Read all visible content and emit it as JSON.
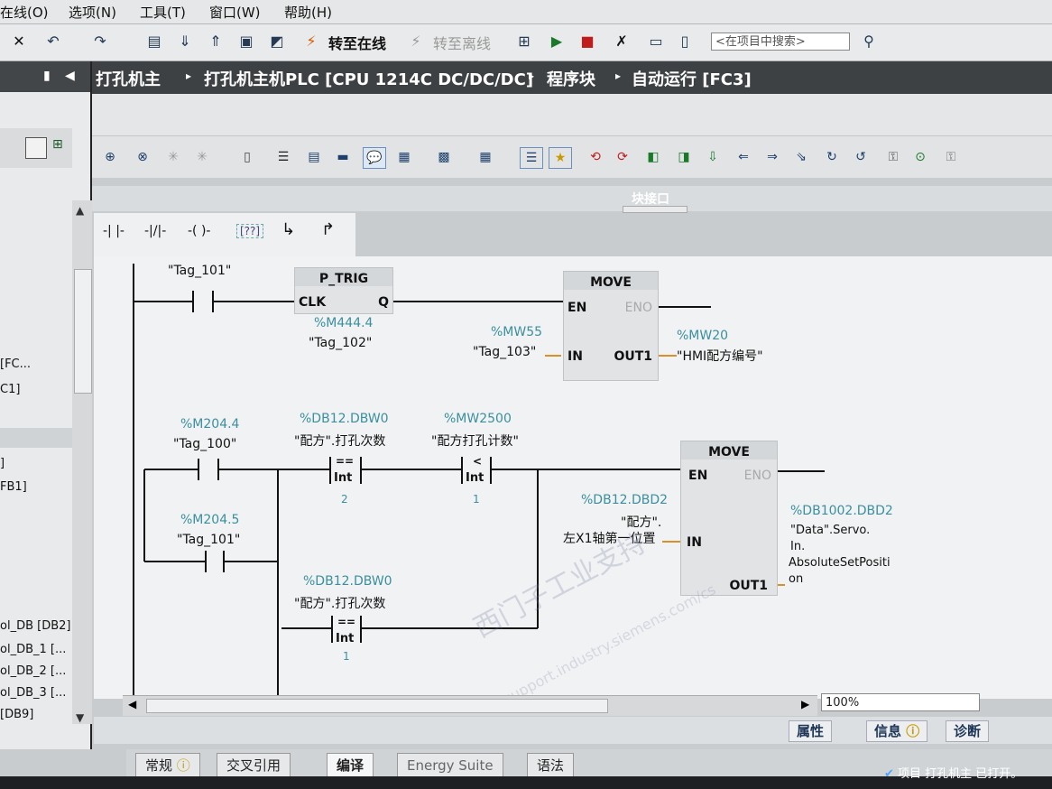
{
  "menu": [
    "在线(O)",
    "选项(N)",
    "工具(T)",
    "窗口(W)",
    "帮助(H)"
  ],
  "toolbar": {
    "go_online": "转至在线",
    "go_offline": "转至离线",
    "search_placeholder": "<在项目中搜索>"
  },
  "breadcrumb": [
    "打孔机主",
    "打孔机主机PLC [CPU 1214C DC/DC/DC]",
    "程序块",
    "自动运行 [FC3]"
  ],
  "block_interface_label": "块接口",
  "left_panel": {
    "items": [
      "[FC...",
      "C1]",
      "]",
      "FB1]",
      "ol_DB [DB2]",
      "ol_DB_1 [...",
      "ol_DB_2 [...",
      "ol_DB_3 [...",
      "[DB9]"
    ]
  },
  "network1": {
    "contact_tag": "\"Tag_101\"",
    "ptrig": {
      "title": "P_TRIG",
      "clk": "CLK",
      "q": "Q",
      "addr": "%M444.4",
      "tag": "\"Tag_102\""
    },
    "move": {
      "title": "MOVE",
      "en": "EN",
      "eno": "ENO",
      "in_addr": "%MW55",
      "in_tag": "\"Tag_103\"",
      "in_pin": "IN",
      "out_pin": "OUT1",
      "out_addr": "%MW20",
      "out_tag": "\"HMI配方编号\""
    }
  },
  "network2": {
    "contact1_addr": "%M204.4",
    "contact1_tag": "\"Tag_100\"",
    "contact2_addr": "%M204.5",
    "contact2_tag": "\"Tag_101\"",
    "cmp1": {
      "addr": "%DB12.DBW0",
      "tag": "\"配方\".打孔次数",
      "op": "==",
      "type": "Int",
      "value": "2"
    },
    "cmp2": {
      "addr": "%MW2500",
      "tag": "\"配方打孔计数\"",
      "op": "<",
      "type": "Int",
      "value": "1"
    },
    "cmp3": {
      "addr": "%DB12.DBW0",
      "tag": "\"配方\".打孔次数",
      "op": "==",
      "type": "Int",
      "value": "1"
    },
    "move": {
      "title": "MOVE",
      "en": "EN",
      "eno": "ENO",
      "in_addr": "%DB12.DBD2",
      "in_tag1": "\"配方\".",
      "in_tag2": "左X1轴第一位置",
      "in_pin": "IN",
      "out_pin": "OUT1",
      "out_addr": "%DB1002.DBD2",
      "out_tag1": "\"Data\".Servo.",
      "out_tag2": "In.",
      "out_tag3": "AbsoluteSetPositi",
      "out_tag4": "on"
    }
  },
  "watermark": {
    "line1": "西门子工业支持",
    "line2": "support.industry.siemens.com/cs"
  },
  "zoom": "100%",
  "properties_tabs": [
    "属性",
    "信息",
    "诊断"
  ],
  "bottom_tabs": [
    "常规",
    "交叉引用",
    "编译",
    "Energy Suite",
    "语法"
  ],
  "status": "项目 打孔机主 已打开。",
  "lad_tools": [
    "-| |-",
    "-|/|-",
    "-( )-",
    "[??]",
    "↳",
    "↱"
  ]
}
